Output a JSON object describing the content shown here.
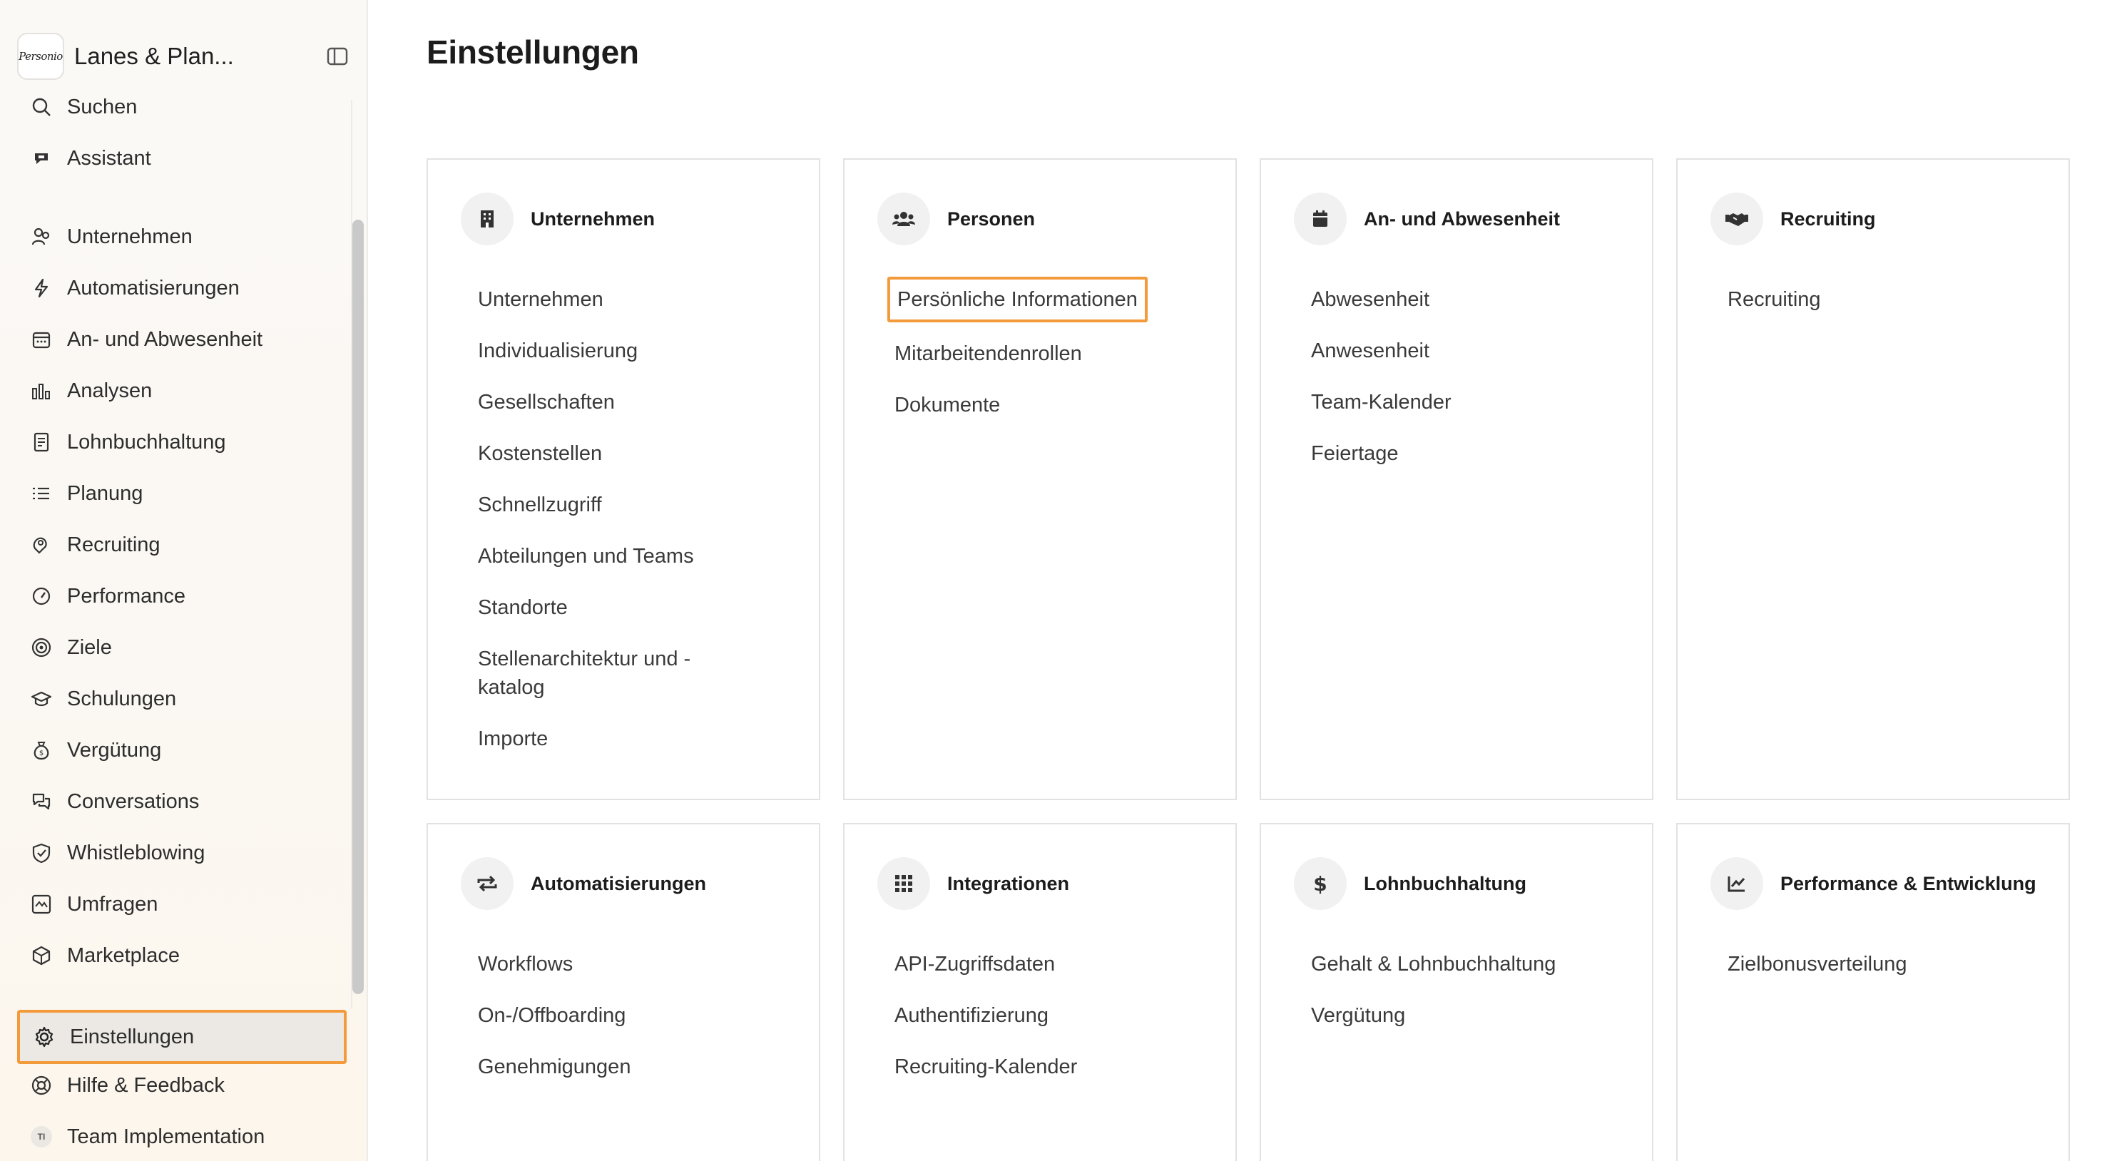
{
  "sidebar": {
    "company_name": "Lanes & Plan...",
    "logo_text": "Personio",
    "items": [
      {
        "label": "Suchen",
        "icon": "search-icon"
      },
      {
        "label": "Assistant",
        "icon": "assistant-icon"
      },
      {
        "label": "Unternehmen",
        "icon": "company-icon"
      },
      {
        "label": "Automatisierungen",
        "icon": "lightning-icon"
      },
      {
        "label": "An- und Abwesenheit",
        "icon": "calendar-icon"
      },
      {
        "label": "Analysen",
        "icon": "bar-chart-icon"
      },
      {
        "label": "Lohnbuchhaltung",
        "icon": "payroll-icon"
      },
      {
        "label": "Planung",
        "icon": "list-icon"
      },
      {
        "label": "Recruiting",
        "icon": "recruiting-icon"
      },
      {
        "label": "Performance",
        "icon": "gauge-icon"
      },
      {
        "label": "Ziele",
        "icon": "target-icon"
      },
      {
        "label": "Schulungen",
        "icon": "graduation-cap-icon"
      },
      {
        "label": "Vergütung",
        "icon": "money-bag-icon"
      },
      {
        "label": "Conversations",
        "icon": "chat-icon"
      },
      {
        "label": "Whistleblowing",
        "icon": "shield-check-icon"
      },
      {
        "label": "Umfragen",
        "icon": "survey-icon"
      },
      {
        "label": "Marketplace",
        "icon": "box-icon"
      },
      {
        "label": "Einstellungen",
        "icon": "gear-icon"
      },
      {
        "label": "Hilfe & Feedback",
        "icon": "lifebuoy-icon"
      },
      {
        "label": "Team Implementation",
        "icon": "avatar-icon",
        "badge": "TI"
      }
    ]
  },
  "main": {
    "title": "Einstellungen",
    "cards": [
      {
        "title": "Unternehmen",
        "icon": "building-icon",
        "links": [
          "Unternehmen",
          "Individualisierung",
          "Gesellschaften",
          "Kostenstellen",
          "Schnellzugriff",
          "Abteilungen und Teams",
          "Standorte",
          "Stellenarchitektur und -",
          "katalog",
          "Importe"
        ]
      },
      {
        "title": "Personen",
        "icon": "people-icon",
        "links": [
          "Persönliche Informationen",
          "Mitarbeitendenrollen",
          "Dokumente"
        ]
      },
      {
        "title": "An- und Abwesenheit",
        "icon": "calendar-filled-icon",
        "links": [
          "Abwesenheit",
          "Anwesenheit",
          "Team-Kalender",
          "Feiertage"
        ]
      },
      {
        "title": "Recruiting",
        "icon": "handshake-icon",
        "links": [
          "Recruiting"
        ]
      },
      {
        "title": "Automatisierungen",
        "icon": "repeat-icon",
        "links": [
          "Workflows",
          "On-/Offboarding",
          "Genehmigungen"
        ]
      },
      {
        "title": "Integrationen",
        "icon": "grid-icon",
        "links": [
          "API-Zugriffsdaten",
          "Authentifizierung",
          "Recruiting-Kalender"
        ]
      },
      {
        "title": "Lohnbuchhaltung",
        "icon": "dollar-icon",
        "links": [
          "Gehalt & Lohnbuchhaltung",
          "Vergütung"
        ]
      },
      {
        "title": "Performance & Entwicklung",
        "icon": "trend-chart-icon",
        "links": [
          "Zielbonusverteilung"
        ]
      }
    ]
  },
  "colors": {
    "highlight": "#f39a3a",
    "active_bg": "#ece9e4"
  }
}
